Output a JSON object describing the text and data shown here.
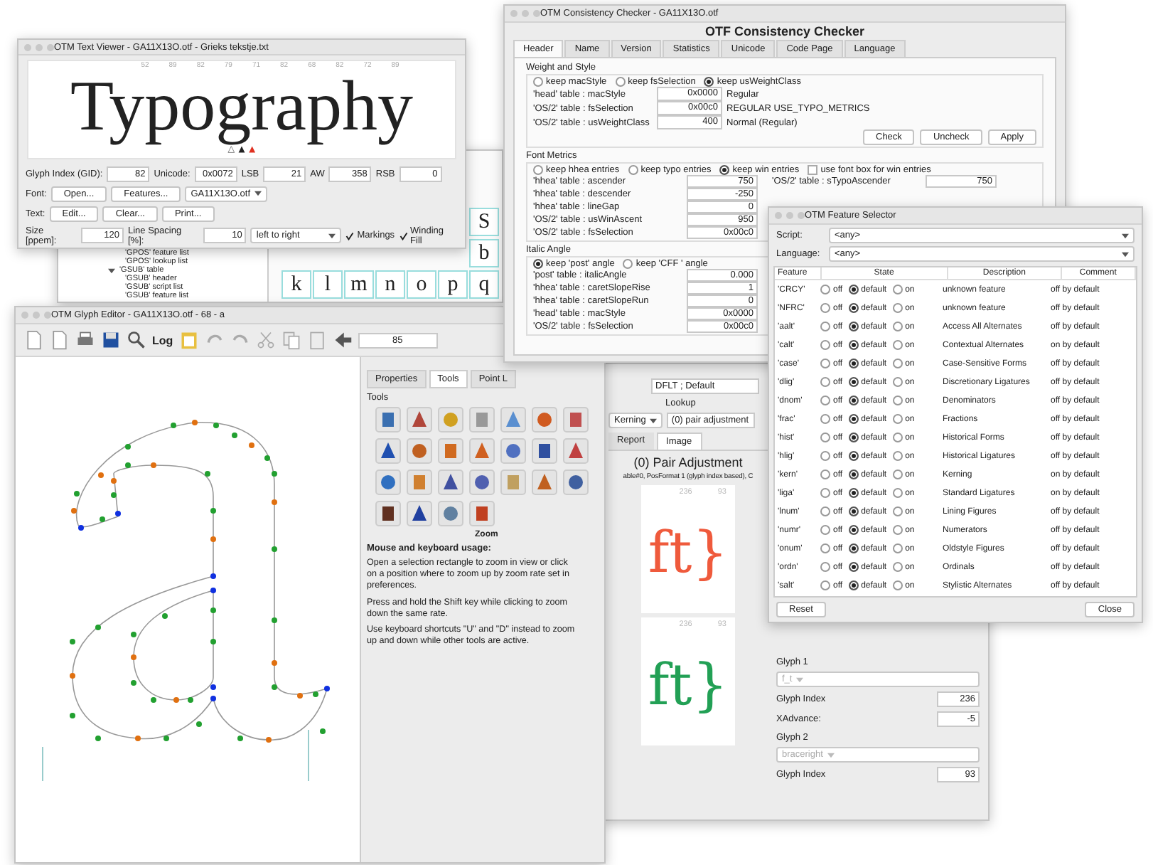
{
  "text_viewer": {
    "title": "OTM Text Viewer - GA11X13O.otf - Grieks tekstje.txt",
    "column_numbers": [
      "52",
      "89",
      "82",
      "79",
      "71",
      "82",
      "68",
      "82",
      "72",
      "89"
    ],
    "sample_text": "Typography",
    "fields_row": [
      {
        "label": "Glyph Index (GID):",
        "value": "82"
      },
      {
        "label": "Unicode:",
        "value": "0x0072"
      },
      {
        "label": "LSB",
        "value": "21"
      },
      {
        "label": "AW",
        "value": "358"
      },
      {
        "label": "RSB",
        "value": "0"
      }
    ],
    "font_row": {
      "label": "Font:",
      "buttons": [
        "Open...",
        "Features..."
      ],
      "select": "GA11X13O.otf"
    },
    "text_row": {
      "label": "Text:",
      "buttons": [
        "Edit...",
        "Clear...",
        "Print..."
      ]
    },
    "size_row": {
      "size_label": "Size [ppem]:",
      "size": "120",
      "spacing_label": "Line Spacing [%]:",
      "spacing": "10",
      "direction": "left to right",
      "checkboxes": [
        {
          "label": "Markings",
          "checked": true
        },
        {
          "label": "Winding Fill",
          "checked": true
        }
      ]
    }
  },
  "main_window": {
    "tree": [
      {
        "label": "'GPOS' feature list"
      },
      {
        "label": "'GPOS' lookup list"
      },
      {
        "label": "'GSUB' table",
        "expanded": true,
        "children": [
          {
            "label": "'GSUB' header"
          },
          {
            "label": "'GSUB' script list"
          },
          {
            "label": "'GSUB' feature list"
          }
        ]
      }
    ],
    "glyph_rows": [
      [
        "S"
      ],
      [
        "b"
      ],
      [
        "k",
        "l",
        "m",
        "n",
        "o",
        "p",
        "q"
      ]
    ]
  },
  "glyph_editor": {
    "title": "OTM Glyph Editor - GA11X13O.otf - 68 - a",
    "log_button": "Log",
    "glyph_field": "85",
    "tabs": [
      {
        "label": "Properties",
        "selected": false
      },
      {
        "label": "Tools",
        "selected": true
      },
      {
        "label": "Point L",
        "selected": false
      }
    ],
    "tools_label": "Tools",
    "active_tool": "Zoom",
    "usage_title": "Mouse and keyboard usage:",
    "usage_paragraphs": [
      "Open a selection rectangle to zoom in view or click on a position where to zoom up by zoom rate set in preferences.",
      "Press and hold the Shift key while clicking to zoom down the same rate.",
      "Use keyboard shortcuts \"U\" and \"D\" instead to zoom up and down while other tools are active."
    ]
  },
  "lookup_window": {
    "language_field": "DFLT ; Default",
    "lookup_label": "Lookup",
    "lookup_type": "Kerning",
    "lookup_field": "(0) pair adjustment",
    "tabs": [
      {
        "label": "Report",
        "selected": false
      },
      {
        "label": "Image",
        "selected": true
      }
    ],
    "heading": "(0) Pair Adjustment",
    "subheading": "able#0, PosFormat 1 (glyph index based), C",
    "previews": [
      {
        "numbers": [
          "236",
          "93"
        ],
        "glyphs": "ft}",
        "color": "#ef5a3c"
      },
      {
        "numbers": [
          "236",
          "93"
        ],
        "glyphs": "ft}",
        "color": "#22a055"
      }
    ],
    "glyph_panel": [
      {
        "title": "Glyph 1",
        "select": "f_t",
        "fields": [
          {
            "label": "Glyph Index",
            "value": "236"
          },
          {
            "label": "XAdvance:",
            "value": "-5"
          }
        ]
      },
      {
        "title": "Glyph 2",
        "select": "braceright",
        "fields": [
          {
            "label": "Glyph Index",
            "value": "93"
          }
        ]
      }
    ]
  },
  "consistency_checker": {
    "title": "OTM Consistency Checker - GA11X13O.otf",
    "heading": "OTF Consistency Checker",
    "tabs": [
      {
        "label": "Header",
        "selected": true
      },
      {
        "label": "Name",
        "selected": false
      },
      {
        "label": "Version",
        "selected": false
      },
      {
        "label": "Statistics",
        "selected": false
      },
      {
        "label": "Unicode",
        "selected": false
      },
      {
        "label": "Code Page",
        "selected": false
      },
      {
        "label": "Language",
        "selected": false
      }
    ],
    "weight_and_style": {
      "title": "Weight and Style",
      "options": [
        {
          "label": "keep macStyle",
          "selected": false
        },
        {
          "label": "keep fsSelection",
          "selected": false
        },
        {
          "label": "keep usWeightClass",
          "selected": true
        }
      ],
      "rows": [
        {
          "label": "'head' table : macStyle",
          "value": "0x0000",
          "note": "Regular"
        },
        {
          "label": "'OS/2' table : fsSelection",
          "value": "0x00c0",
          "note": "REGULAR USE_TYPO_METRICS"
        },
        {
          "label": "'OS/2' table : usWeightClass",
          "value": "400",
          "note": "Normal (Regular)"
        }
      ],
      "buttons": [
        "Check",
        "Uncheck",
        "Apply"
      ]
    },
    "font_metrics": {
      "title": "Font Metrics",
      "options": [
        {
          "label": "keep hhea entries",
          "selected": false
        },
        {
          "label": "keep typo entries",
          "selected": false
        },
        {
          "label": "keep win entries",
          "selected": true
        }
      ],
      "checkbox": {
        "label": "use font box for win entries",
        "checked": false
      },
      "rows": [
        {
          "label": "'hhea' table : ascender",
          "value": "750"
        },
        {
          "label": "'hhea' table : descender",
          "value": "-250"
        },
        {
          "label": "'hhea' table : lineGap",
          "value": "0"
        },
        {
          "label": "'OS/2' table : usWinAscent",
          "value": "950"
        },
        {
          "label": "'OS/2' table : fsSelection",
          "value": "0x00c0"
        }
      ],
      "right_rows": [
        {
          "label": "'OS/2' table : sTypoAscender",
          "value": "750"
        }
      ]
    },
    "italic_angle": {
      "title": "Italic Angle",
      "options": [
        {
          "label": "keep 'post' angle",
          "selected": true
        },
        {
          "label": "keep 'CFF ' angle",
          "selected": false
        }
      ],
      "rows": [
        {
          "label": "'post' table : italicAngle",
          "value": "0.000"
        },
        {
          "label": "'hhea' table : caretSlopeRise",
          "value": "1"
        },
        {
          "label": "'hhea' table : caretSlopeRun",
          "value": "0"
        },
        {
          "label": "'head' table : macStyle",
          "value": "0x0000"
        },
        {
          "label": "'OS/2' table : fsSelection",
          "value": "0x00c0"
        }
      ]
    }
  },
  "feature_selector": {
    "title": "OTM Feature Selector",
    "script_label": "Script:",
    "script": "<any>",
    "language_label": "Language:",
    "language": "<any>",
    "columns": [
      "Feature",
      "State",
      "Description",
      "Comment"
    ],
    "rows": [
      {
        "feature": "'CRCY'",
        "options": [
          {
            "label": "off",
            "selected": false
          },
          {
            "label": "default",
            "selected": true
          },
          {
            "label": "on",
            "selected": false
          }
        ],
        "description": "unknown feature",
        "comment": "off by default"
      },
      {
        "feature": "'NFRC'",
        "options": [
          {
            "label": "off",
            "selected": false
          },
          {
            "label": "default",
            "selected": true
          },
          {
            "label": "on",
            "selected": false
          }
        ],
        "description": "unknown feature",
        "comment": "off by default"
      },
      {
        "feature": "'aalt'",
        "options": [
          {
            "label": "off",
            "selected": false
          },
          {
            "label": "default",
            "selected": true
          },
          {
            "label": "on",
            "selected": false
          }
        ],
        "description": "Access All Alternates",
        "comment": "off by default"
      },
      {
        "feature": "'calt'",
        "options": [
          {
            "label": "off",
            "selected": false
          },
          {
            "label": "default",
            "selected": true
          },
          {
            "label": "on",
            "selected": false
          }
        ],
        "description": "Contextual Alternates",
        "comment": "on by default"
      },
      {
        "feature": "'case'",
        "options": [
          {
            "label": "off",
            "selected": false
          },
          {
            "label": "default",
            "selected": true
          },
          {
            "label": "on",
            "selected": false
          }
        ],
        "description": "Case-Sensitive Forms",
        "comment": "off by default"
      },
      {
        "feature": "'dlig'",
        "options": [
          {
            "label": "off",
            "selected": false
          },
          {
            "label": "default",
            "selected": true
          },
          {
            "label": "on",
            "selected": false
          }
        ],
        "description": "Discretionary Ligatures",
        "comment": "off by default"
      },
      {
        "feature": "'dnom'",
        "options": [
          {
            "label": "off",
            "selected": false
          },
          {
            "label": "default",
            "selected": true
          },
          {
            "label": "on",
            "selected": false
          }
        ],
        "description": "Denominators",
        "comment": "off by default"
      },
      {
        "feature": "'frac'",
        "options": [
          {
            "label": "off",
            "selected": false
          },
          {
            "label": "default",
            "selected": true
          },
          {
            "label": "on",
            "selected": false
          }
        ],
        "description": "Fractions",
        "comment": "off by default"
      },
      {
        "feature": "'hist'",
        "options": [
          {
            "label": "off",
            "selected": false
          },
          {
            "label": "default",
            "selected": true
          },
          {
            "label": "on",
            "selected": false
          }
        ],
        "description": "Historical Forms",
        "comment": "off by default"
      },
      {
        "feature": "'hlig'",
        "options": [
          {
            "label": "off",
            "selected": false
          },
          {
            "label": "default",
            "selected": true
          },
          {
            "label": "on",
            "selected": false
          }
        ],
        "description": "Historical Ligatures",
        "comment": "off by default"
      },
      {
        "feature": "'kern'",
        "options": [
          {
            "label": "off",
            "selected": false
          },
          {
            "label": "default",
            "selected": true
          },
          {
            "label": "on",
            "selected": false
          }
        ],
        "description": "Kerning",
        "comment": "on by default"
      },
      {
        "feature": "'liga'",
        "options": [
          {
            "label": "off",
            "selected": false
          },
          {
            "label": "default",
            "selected": true
          },
          {
            "label": "on",
            "selected": false
          }
        ],
        "description": "Standard Ligatures",
        "comment": "on by default"
      },
      {
        "feature": "'lnum'",
        "options": [
          {
            "label": "off",
            "selected": false
          },
          {
            "label": "default",
            "selected": true
          },
          {
            "label": "on",
            "selected": false
          }
        ],
        "description": "Lining Figures",
        "comment": "off by default"
      },
      {
        "feature": "'numr'",
        "options": [
          {
            "label": "off",
            "selected": false
          },
          {
            "label": "default",
            "selected": true
          },
          {
            "label": "on",
            "selected": false
          }
        ],
        "description": "Numerators",
        "comment": "off by default"
      },
      {
        "feature": "'onum'",
        "options": [
          {
            "label": "off",
            "selected": false
          },
          {
            "label": "default",
            "selected": true
          },
          {
            "label": "on",
            "selected": false
          }
        ],
        "description": "Oldstyle Figures",
        "comment": "off by default"
      },
      {
        "feature": "'ordn'",
        "options": [
          {
            "label": "off",
            "selected": false
          },
          {
            "label": "default",
            "selected": true
          },
          {
            "label": "on",
            "selected": false
          }
        ],
        "description": "Ordinals",
        "comment": "off by default"
      },
      {
        "feature": "'salt'",
        "options": [
          {
            "label": "off",
            "selected": false
          },
          {
            "label": "default",
            "selected": true
          },
          {
            "label": "on",
            "selected": false
          }
        ],
        "description": "Stylistic Alternates",
        "comment": "off by default"
      }
    ],
    "buttons": [
      "Reset",
      "Close"
    ]
  }
}
